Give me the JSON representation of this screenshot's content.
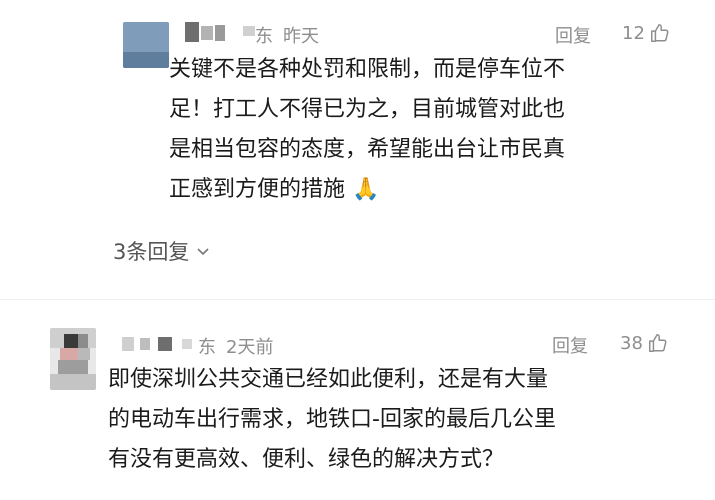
{
  "comments": [
    {
      "name_suffix": "东",
      "time": "昨天",
      "reply_label": "回复",
      "like_count": "12",
      "text_lines": [
        "关键不是各种处罚和限制，而是停车位不",
        "足！打工人不得已为之，目前城管对此也",
        "是相当包容的态度，希望能出台让市民真",
        "正感到方便的措施 🙏"
      ],
      "more_replies": "3条回复"
    },
    {
      "name_suffix": "东",
      "time": "2天前",
      "reply_label": "回复",
      "like_count": "38",
      "text_lines": [
        "即使深圳公共交通已经如此便利，还是有大量",
        "的电动车出行需求，地铁口-回家的最后几公里",
        "有没有更高效、便利、绿色的解决方式？"
      ]
    }
  ],
  "colors": {
    "secondary_text": "#8e8e8e",
    "body_text": "#1b1b1b",
    "avatar_blur": "#6f8fb0"
  },
  "icons": {
    "like": "thumbs-up-icon",
    "expand": "chevron-down-icon"
  }
}
